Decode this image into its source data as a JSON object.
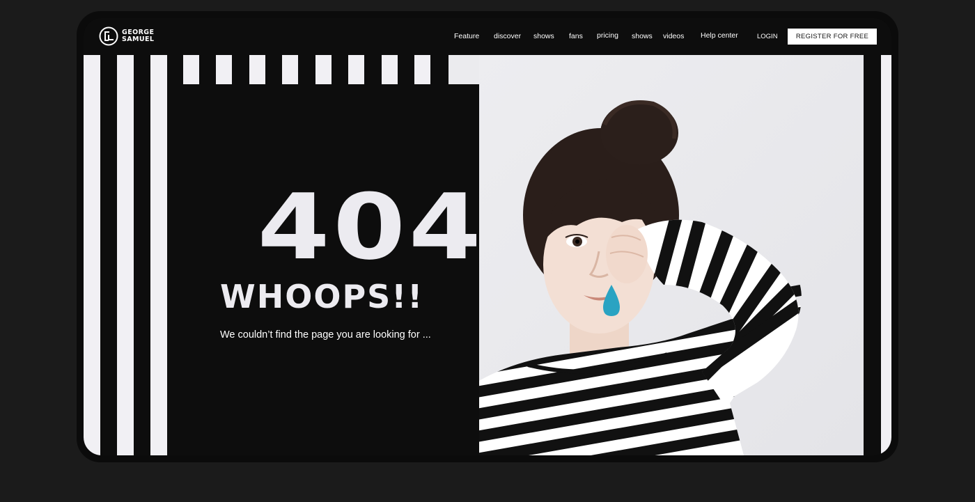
{
  "brand": {
    "logo_icon": "gs-monogram-icon",
    "name_line1": "GEORGE",
    "name_line2": "SAMUEL"
  },
  "nav": {
    "items": [
      {
        "label": "Feature"
      },
      {
        "label": "discover"
      },
      {
        "label": "shows"
      },
      {
        "label": "fans"
      },
      {
        "label": "pricing"
      },
      {
        "label": "shows"
      },
      {
        "label": "videos"
      },
      {
        "label": "Help center"
      }
    ],
    "login_label": "LOGIN",
    "register_label": "REGISTER FOR FREE"
  },
  "error": {
    "code": "404",
    "headline": "WHOOPS!!",
    "message": "We couldn’t find the page you are looking for ..."
  },
  "colors": {
    "background": "#1b1b1b",
    "panel": "#0d0d0d",
    "stripe": "#f1f0f4",
    "tear": "#2aa3c2"
  },
  "hero_image": {
    "icon": "crying-girl-illustration"
  }
}
